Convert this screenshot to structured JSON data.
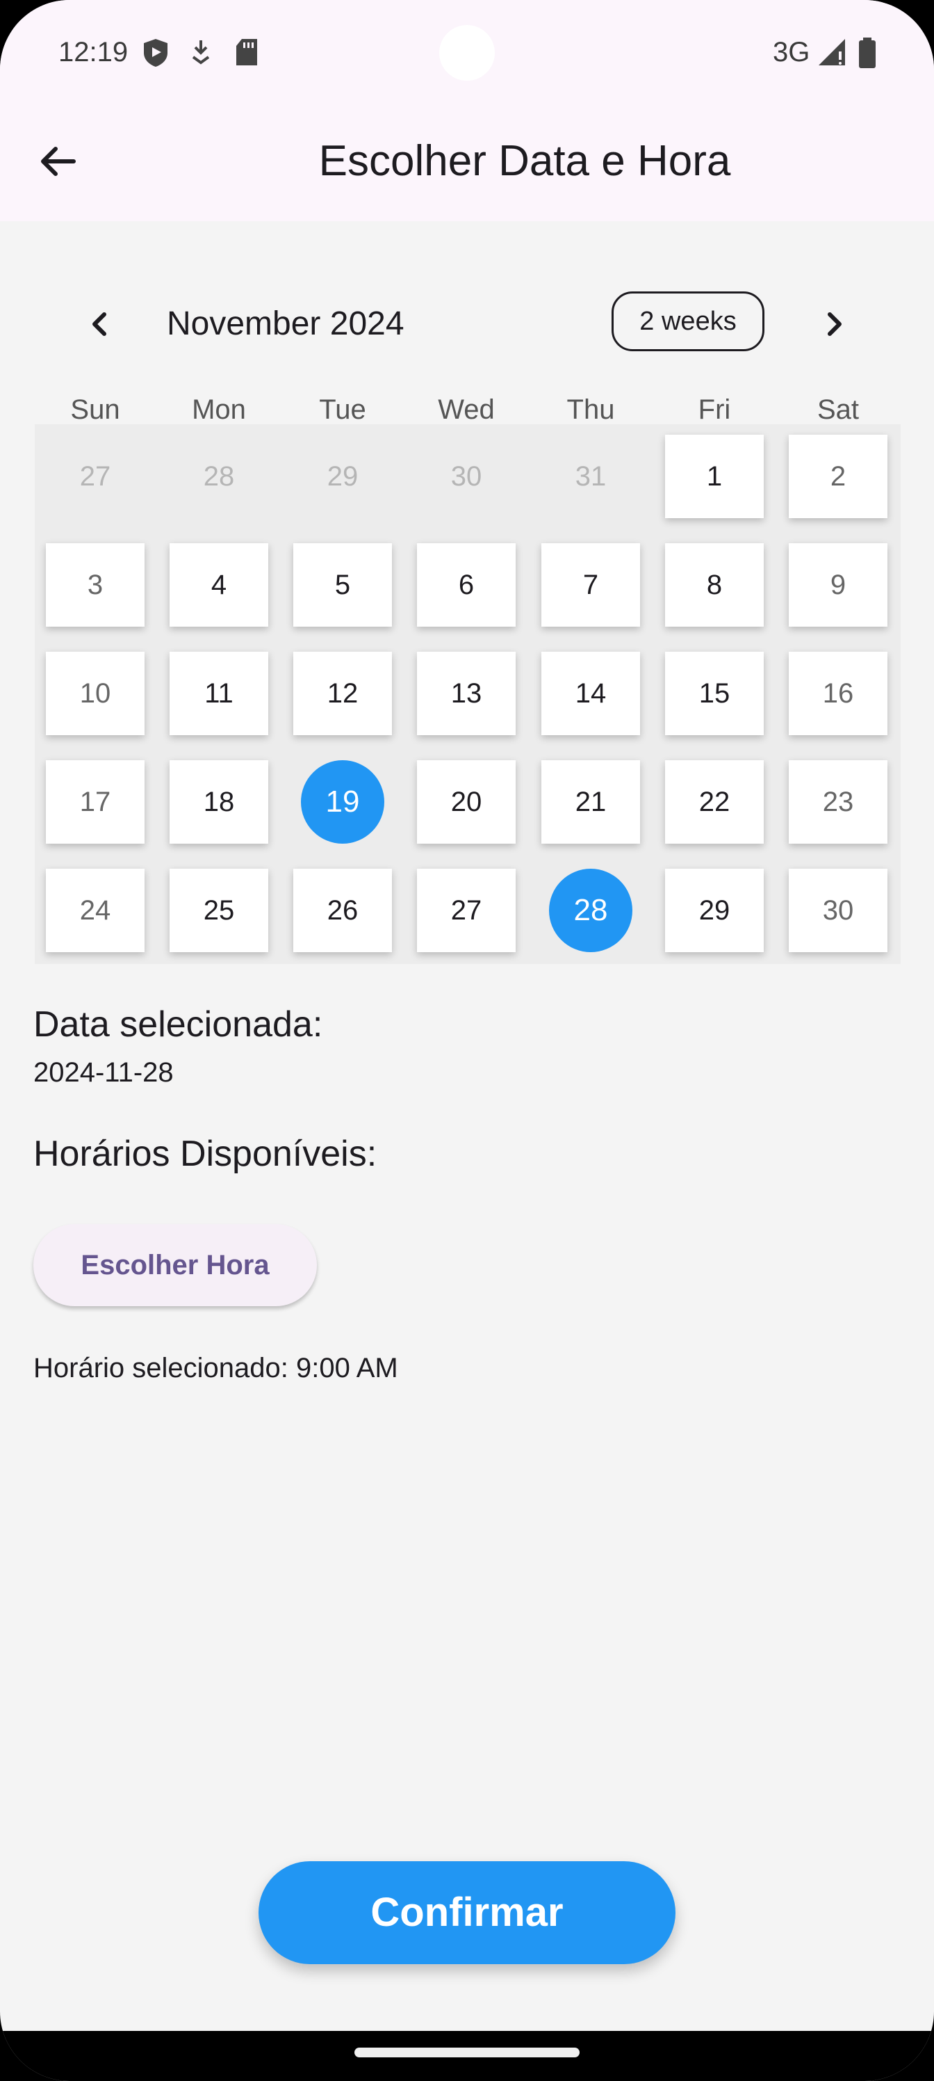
{
  "status_bar": {
    "time": "12:19",
    "network": "3G",
    "left_icons": [
      "shield-icon",
      "download-arrow-icon",
      "sd-card-icon"
    ],
    "right_icons": [
      "signal-icon",
      "battery-icon"
    ]
  },
  "app_bar": {
    "back_icon": "arrow-left-icon",
    "title": "Escolher Data e Hora"
  },
  "calendar": {
    "month_label": "November 2024",
    "format_button": "2 weeks",
    "prev_icon": "chevron-left-icon",
    "next_icon": "chevron-right-icon",
    "days_of_week": [
      "Sun",
      "Mon",
      "Tue",
      "Wed",
      "Thu",
      "Fri",
      "Sat"
    ],
    "weeks": [
      [
        {
          "d": "27",
          "type": "outside"
        },
        {
          "d": "28",
          "type": "outside"
        },
        {
          "d": "29",
          "type": "outside"
        },
        {
          "d": "30",
          "type": "outside"
        },
        {
          "d": "31",
          "type": "outside"
        },
        {
          "d": "1",
          "type": "day"
        },
        {
          "d": "2",
          "type": "weekend"
        }
      ],
      [
        {
          "d": "3",
          "type": "weekend"
        },
        {
          "d": "4",
          "type": "day"
        },
        {
          "d": "5",
          "type": "day"
        },
        {
          "d": "6",
          "type": "day"
        },
        {
          "d": "7",
          "type": "day"
        },
        {
          "d": "8",
          "type": "day"
        },
        {
          "d": "9",
          "type": "weekend"
        }
      ],
      [
        {
          "d": "10",
          "type": "weekend"
        },
        {
          "d": "11",
          "type": "day"
        },
        {
          "d": "12",
          "type": "day"
        },
        {
          "d": "13",
          "type": "day"
        },
        {
          "d": "14",
          "type": "day"
        },
        {
          "d": "15",
          "type": "day"
        },
        {
          "d": "16",
          "type": "weekend"
        }
      ],
      [
        {
          "d": "17",
          "type": "weekend"
        },
        {
          "d": "18",
          "type": "day"
        },
        {
          "d": "19",
          "type": "selected"
        },
        {
          "d": "20",
          "type": "day"
        },
        {
          "d": "21",
          "type": "day"
        },
        {
          "d": "22",
          "type": "day"
        },
        {
          "d": "23",
          "type": "weekend"
        }
      ],
      [
        {
          "d": "24",
          "type": "weekend"
        },
        {
          "d": "25",
          "type": "day"
        },
        {
          "d": "26",
          "type": "day"
        },
        {
          "d": "27",
          "type": "day"
        },
        {
          "d": "28",
          "type": "selected"
        },
        {
          "d": "29",
          "type": "day"
        },
        {
          "d": "30",
          "type": "weekend"
        }
      ]
    ],
    "highlight_color": "#2196f3"
  },
  "selection": {
    "date_label": "Data selecionada:",
    "date_value": "2024-11-28",
    "hours_label": "Horários Disponíveis:",
    "pick_time_button": "Escolher Hora",
    "selected_time_text": "Horário selecionado: 9:00 AM"
  },
  "footer": {
    "confirm_button": "Confirmar"
  },
  "colors": {
    "primary": "#2196f3",
    "app_bar_bg": "#fcf5fc",
    "background": "#f4f4f4",
    "button_text": "#65558f"
  }
}
